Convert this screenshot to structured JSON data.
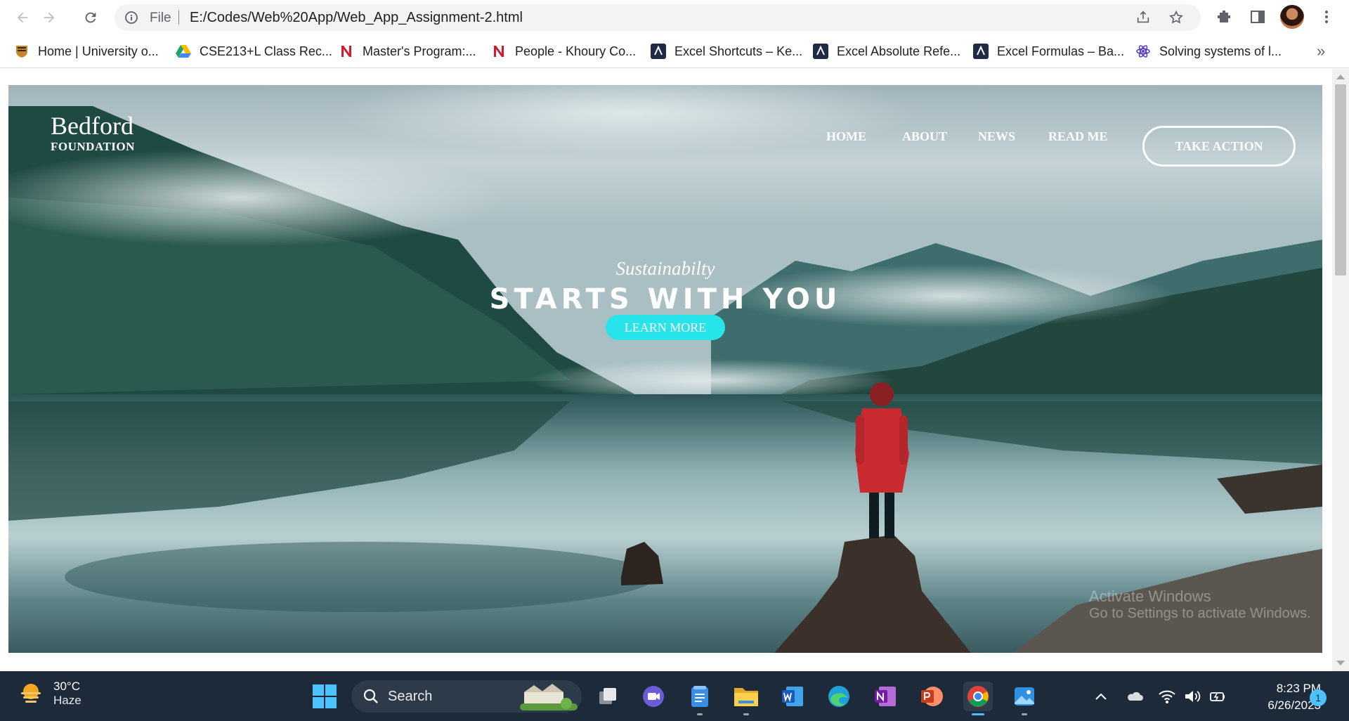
{
  "browser": {
    "file_label": "File",
    "url": "E:/Codes/Web%20App/Web_App_Assignment-2.html"
  },
  "bookmarks": {
    "items": [
      {
        "label": "Home | University o...",
        "icon": "shield-icon",
        "color": "#c5862b"
      },
      {
        "label": "CSE213+L Class Rec...",
        "icon": "google-drive-icon",
        "color": "#1fa463"
      },
      {
        "label": "Master's Program:...",
        "icon": "northeastern-n-icon",
        "color": "#d41b2c"
      },
      {
        "label": "People - Khoury Co...",
        "icon": "northeastern-n-icon",
        "color": "#d41b2c"
      },
      {
        "label": "Excel Shortcuts – Ke...",
        "icon": "exceljet-icon",
        "color": "#1f2a44"
      },
      {
        "label": "Excel Absolute Refe...",
        "icon": "exceljet-icon",
        "color": "#1f2a44"
      },
      {
        "label": "Excel Formulas – Ba...",
        "icon": "exceljet-icon",
        "color": "#1f2a44"
      },
      {
        "label": "Solving systems of l...",
        "icon": "atom-icon",
        "color": "#5a3fc0"
      }
    ],
    "more": "»"
  },
  "site": {
    "brand_name": "Bedford",
    "brand_sub": "FOUNDATION",
    "nav": [
      "HOME",
      "ABOUT",
      "NEWS",
      "READ ME"
    ],
    "cta": "TAKE ACTION",
    "tagline_script": "Sustainabilty",
    "headline": "STARTS WITH YOU",
    "learn_more": "LEARN MORE",
    "accent_color": "#27e3ea",
    "watermark_line1": "Activate Windows",
    "watermark_line2": "Go to Settings to activate Windows."
  },
  "taskbar": {
    "weather_temp": "30°C",
    "weather_desc": "Haze",
    "search_label": "Search",
    "apps": [
      "start-icon",
      "task-view-icon",
      "teams-icon",
      "notepad-icon",
      "file-explorer-icon",
      "word-icon",
      "edge-icon",
      "onenote-icon",
      "powerpoint-icon",
      "chrome-icon",
      "photos-icon"
    ],
    "time": "8:23 PM",
    "date": "6/26/2023",
    "notification_count": "1"
  }
}
